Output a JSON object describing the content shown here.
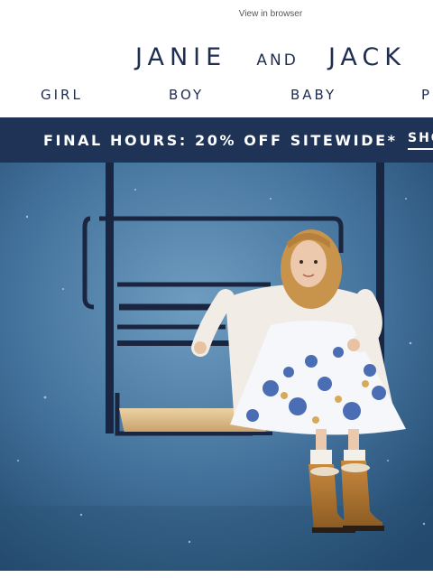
{
  "header": {
    "view_in_browser": "View in browser"
  },
  "logo": {
    "word1": "JANIE",
    "word2": "AND",
    "word3": "JACK"
  },
  "nav": {
    "items": [
      {
        "label": "GIRL"
      },
      {
        "label": "BOY"
      },
      {
        "label": "BABY"
      },
      {
        "label": "P"
      }
    ]
  },
  "promo": {
    "headline": "FINAL HOURS: 20% OFF SITEWIDE*",
    "cta": "SHO"
  },
  "colors": {
    "brand_navy": "#1f2d50",
    "banner_bg": "#1f3357",
    "hero_sky": "#3f6e96"
  }
}
